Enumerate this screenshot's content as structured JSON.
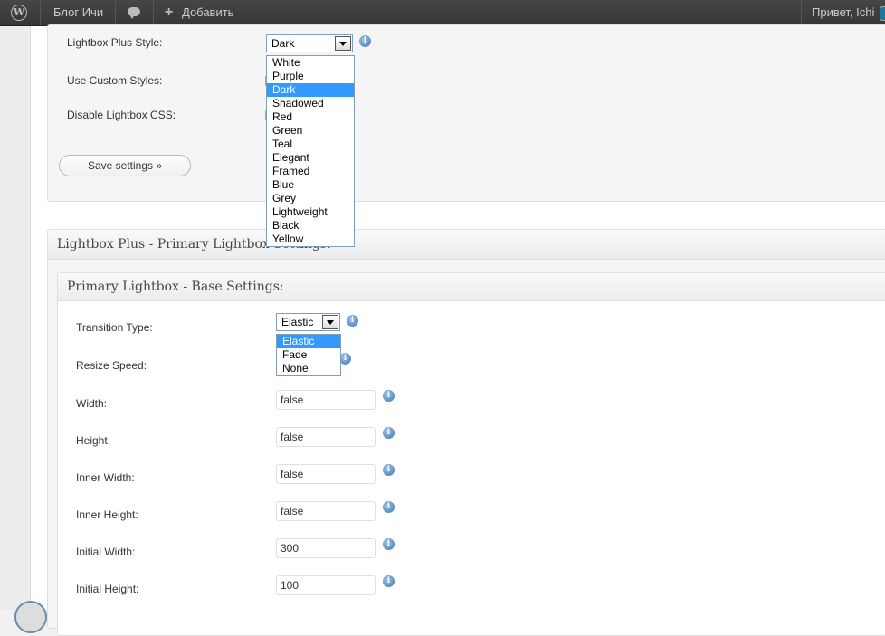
{
  "admin_bar": {
    "site_name": "Блог Ичи",
    "add_label": "Добавить",
    "greeting": "Привет, Ichi"
  },
  "general": {
    "style_label": "Lightbox Plus Style:",
    "style_value": "Dark",
    "style_options": [
      "White",
      "Purple",
      "Dark",
      "Shadowed",
      "Red",
      "Green",
      "Teal",
      "Elegant",
      "Framed",
      "Blue",
      "Grey",
      "Lightweight",
      "Black",
      "Yellow"
    ],
    "custom_styles_label": "Use Custom Styles:",
    "disable_css_label": "Disable Lightbox CSS:",
    "save_label": "Save settings »"
  },
  "primary": {
    "section_title": "Lightbox Plus - Primary Lightbox Settings:",
    "base_title": "Primary Lightbox - Base Settings:",
    "transition_label": "Transition Type:",
    "transition_value": "Elastic",
    "transition_options": [
      "Elastic",
      "Fade",
      "None"
    ],
    "resize_label": "Resize Speed:",
    "fields": [
      {
        "label": "Width:",
        "value": "false"
      },
      {
        "label": "Height:",
        "value": "false"
      },
      {
        "label": "Inner Width:",
        "value": "false"
      },
      {
        "label": "Inner Height:",
        "value": "false"
      },
      {
        "label": "Initial Width:",
        "value": "300"
      },
      {
        "label": "Initial Height:",
        "value": "100"
      }
    ]
  },
  "icons": {
    "info": "i",
    "wp": "W",
    "plus": "+"
  },
  "colors": {
    "admin_bar": "#464646",
    "selection": "#3399ff",
    "info": "#3e76b4"
  }
}
